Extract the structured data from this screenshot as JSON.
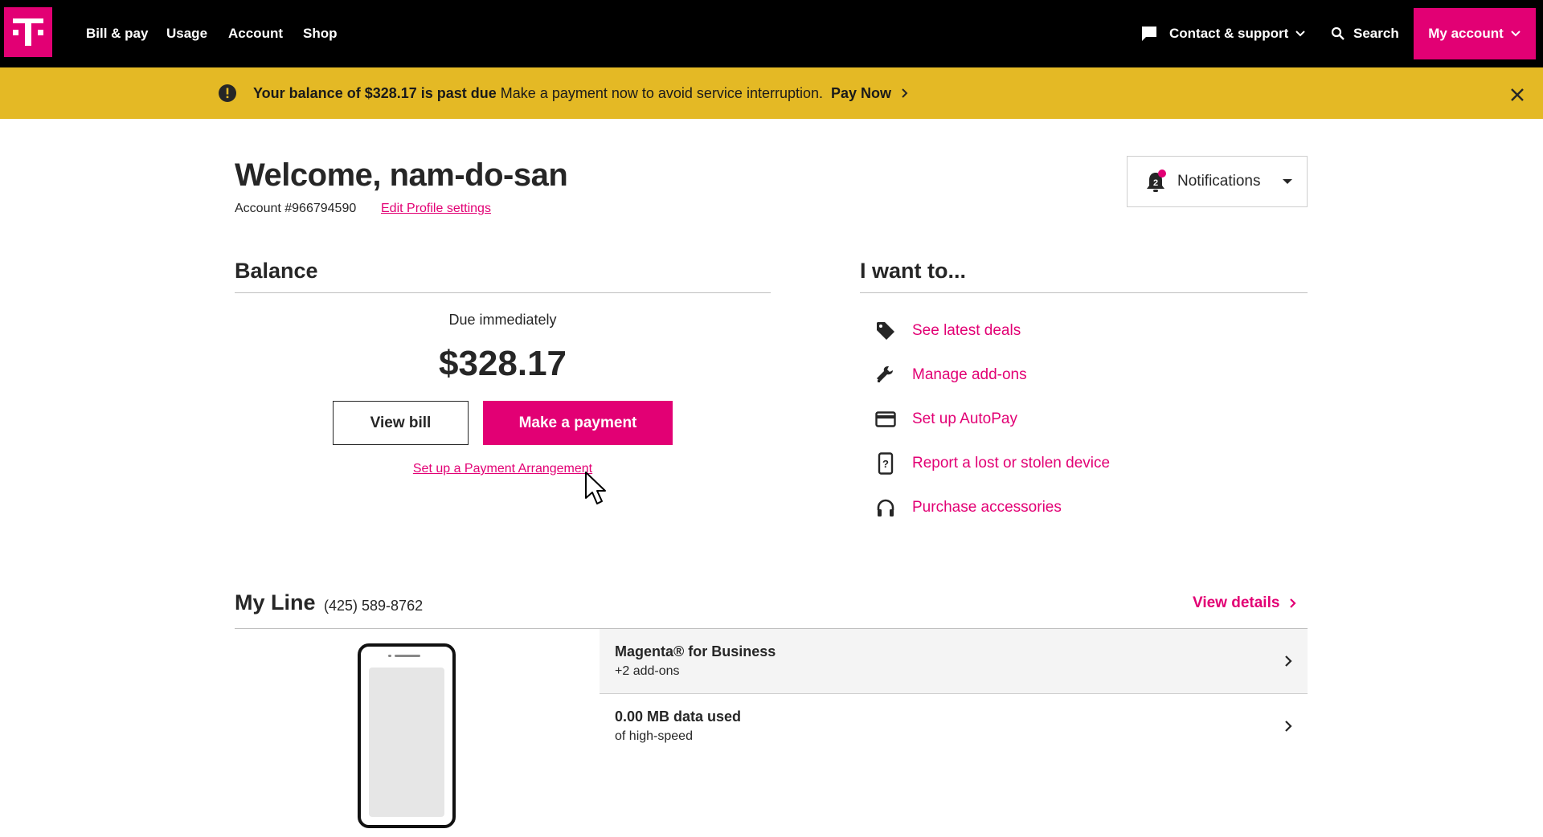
{
  "nav": {
    "links": [
      "Bill & pay",
      "Usage",
      "Account",
      "Shop"
    ],
    "contact_label": "Contact & support",
    "search_label": "Search",
    "my_account_label": "My account"
  },
  "alert": {
    "bold_text": "Your balance of $328.17 is past due",
    "text": "Make a payment now to avoid service interruption.",
    "action": "Pay Now"
  },
  "header": {
    "welcome": "Welcome, nam-do-san",
    "account_number": "Account #966794590",
    "edit_profile": "Edit Profile settings",
    "notifications_label": "Notifications",
    "notifications_count": "2"
  },
  "balance": {
    "title": "Balance",
    "due_label": "Due immediately",
    "amount": "$328.17",
    "view_bill": "View bill",
    "make_payment": "Make a payment",
    "arrangement": "Set up a Payment Arrangement"
  },
  "want_to": {
    "title": "I want to...",
    "items": [
      {
        "label": "See latest deals",
        "icon": "tag-icon"
      },
      {
        "label": "Manage add-ons",
        "icon": "wrench-icon"
      },
      {
        "label": "Set up AutoPay",
        "icon": "credit-card-icon"
      },
      {
        "label": "Report a lost or stolen device",
        "icon": "phone-question-icon"
      },
      {
        "label": "Purchase accessories",
        "icon": "headphones-icon"
      }
    ]
  },
  "my_line": {
    "title": "My Line",
    "phone": "(425) 589-8762",
    "view_details": "View details",
    "rows": [
      {
        "title": "Magenta® for Business",
        "subtitle": "+2 add-ons"
      },
      {
        "title": "0.00 MB data used",
        "subtitle": "of high-speed"
      }
    ]
  },
  "colors": {
    "brand": "#e20074",
    "alert": "#e4b925",
    "nav_bg": "#000000"
  }
}
